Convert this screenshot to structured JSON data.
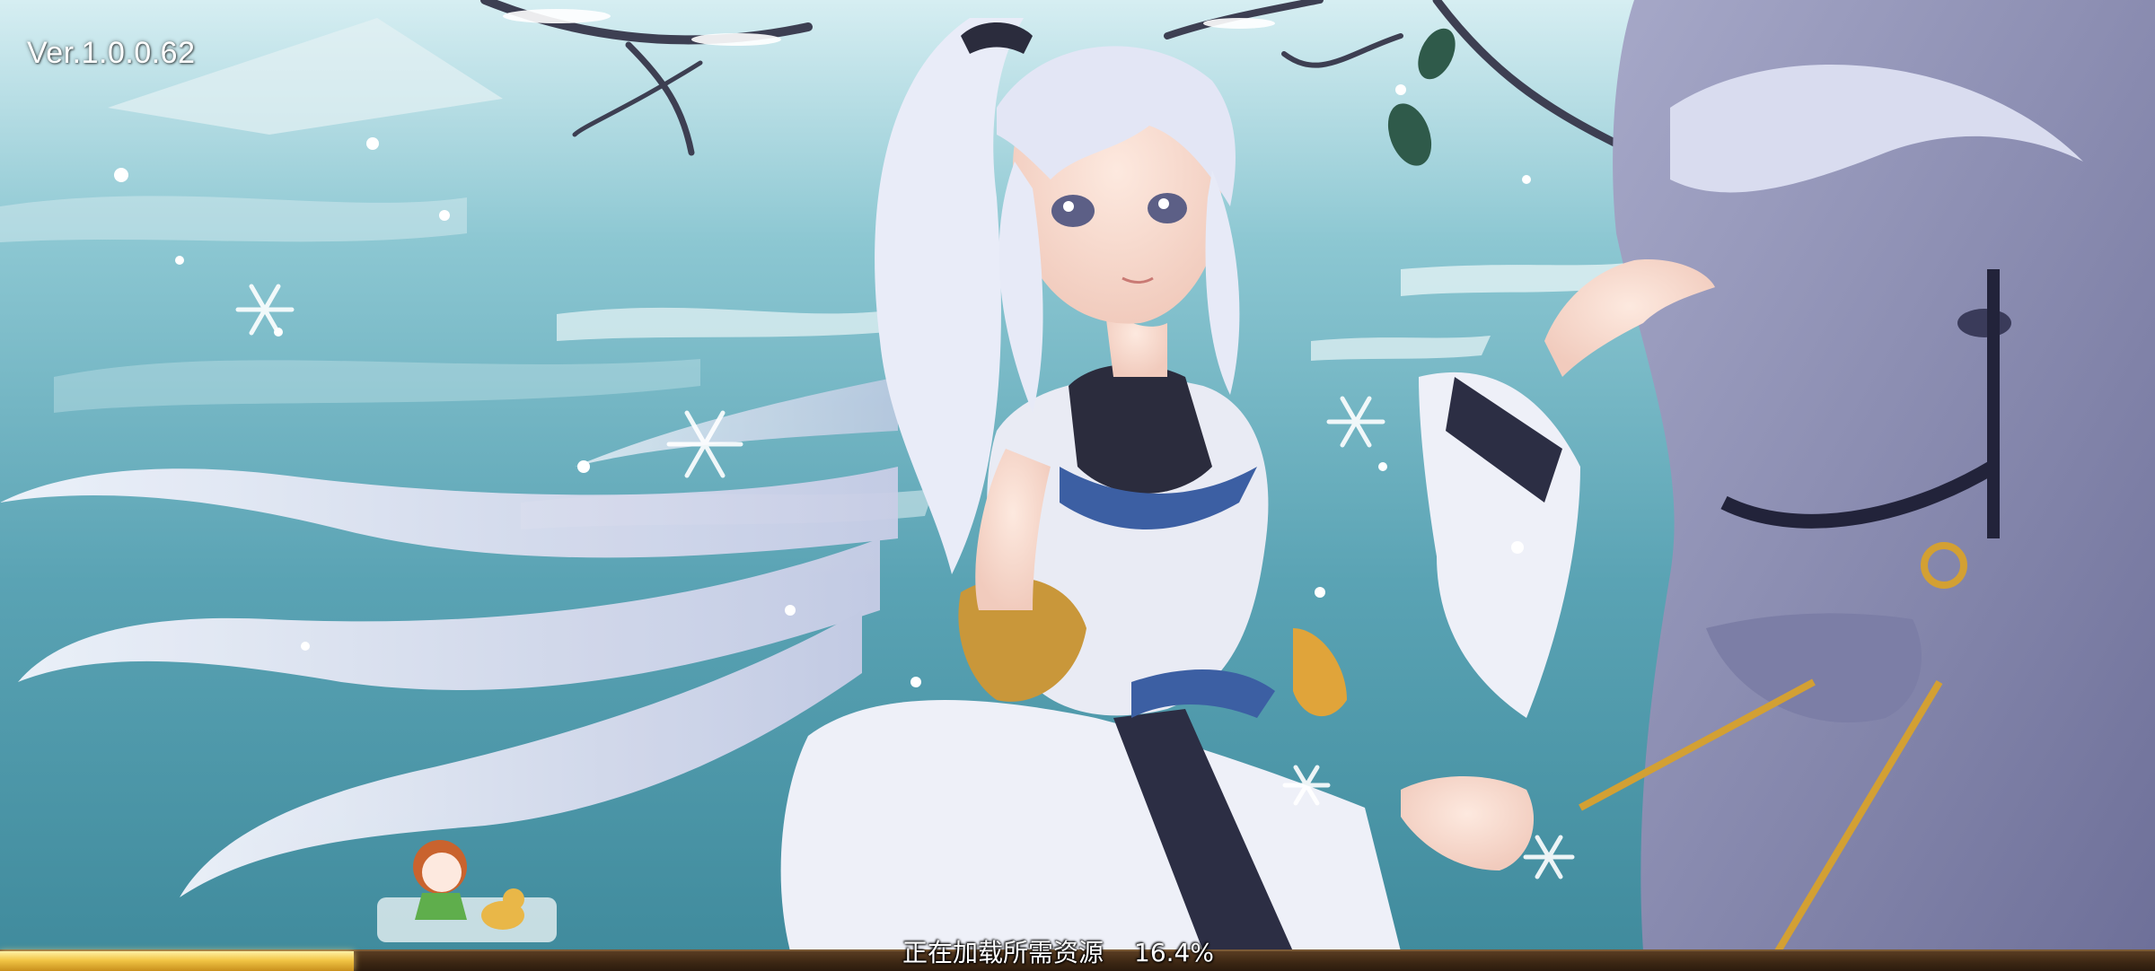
{
  "version_label": "Ver.1.0.0.62",
  "loading": {
    "status_text": "正在加载所需资源",
    "percent_text": "16.4%",
    "progress": 0.164
  },
  "colors": {
    "ice_light": "#bfe3ea",
    "ice_mid": "#6fb3c2",
    "ice_dark": "#3c8798",
    "bar_fill": "#f2c646",
    "bar_track": "#3b2613",
    "horse_body": "#8f91b4",
    "hair": "#e8ebf6"
  },
  "scene": {
    "character": "white-haired-heroine",
    "mount": "grey-horse",
    "chibi": "chibi-girl-and-dog",
    "weather": "snowfall"
  }
}
